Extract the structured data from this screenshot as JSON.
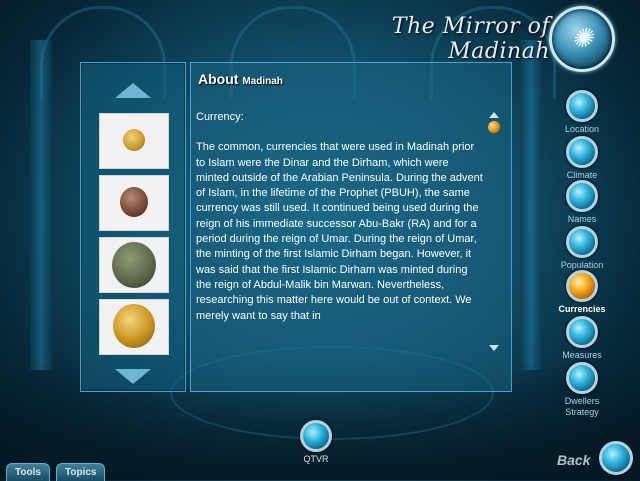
{
  "app": {
    "title": "The Mirror of Madinah",
    "logo_text": "ꜥ"
  },
  "section": {
    "heading": "About",
    "subheading": "Madinah"
  },
  "content": {
    "topic": "Currency:",
    "body": "The common, currencies that were used in Madinah prior to Islam were the Dinar and the Dirham, which were minted outside of the Arabian Peninsula.  During the advent of Islam, in the lifetime of the Prophet (PBUH), the same currency was still used.  It continued being used during the reign of his immediate successor Abu-Bakr (RA) and for a period during the reign of Umar.  During the reign of Umar, the minting of the first Islamic Dirham began. However, it was said that the first Islamic Dirham was minted during the reign of Abdul-Malik bin Marwan. Nevertheless, researching this matter here would be out of context.  We merely want to say that in"
  },
  "thumbnails": [
    {
      "name": "gold-dinar-small",
      "color": "#c99a2e"
    },
    {
      "name": "copper-coin",
      "color": "#7a4a3a"
    },
    {
      "name": "bronze-coin",
      "color": "#5e6a4a"
    },
    {
      "name": "gold-dinar-large",
      "color": "#c8931f"
    }
  ],
  "nav": {
    "items": [
      {
        "label": "Location",
        "active": false
      },
      {
        "label": "Climate",
        "active": false
      },
      {
        "label": "Names",
        "active": false
      },
      {
        "label": "Population",
        "active": false
      },
      {
        "label": "Currencies",
        "active": true
      },
      {
        "label": "Measures",
        "active": false
      },
      {
        "label": "Dwellers Strategy",
        "active": false
      }
    ]
  },
  "bottom": {
    "qtvr_label": "QTVR",
    "back_label": "Back",
    "tools_label": "Tools",
    "topics_label": "Topics"
  },
  "colors": {
    "active_orb": "#f5a81c",
    "orb": "#38b8e0",
    "accent": "#4aa3c6"
  }
}
